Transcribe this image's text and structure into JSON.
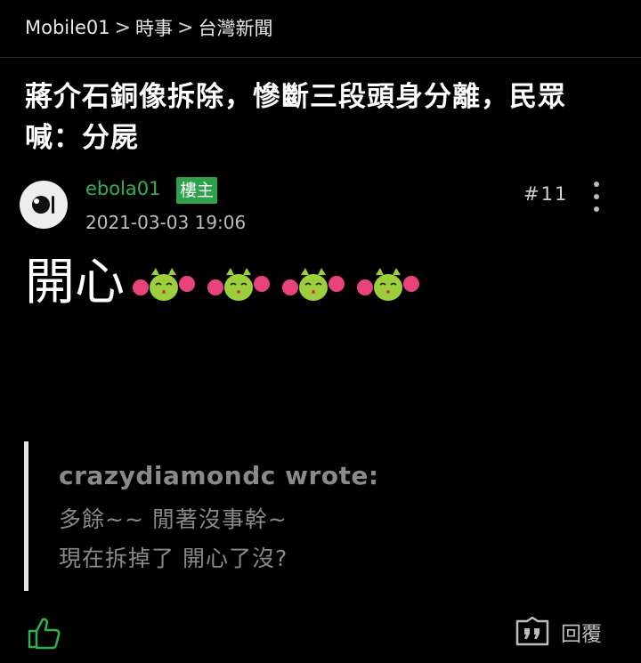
{
  "breadcrumb": {
    "items": [
      "Mobile01",
      "時事",
      "台灣新聞"
    ],
    "separator": ">"
  },
  "post": {
    "title": "蔣介石銅像拆除，慘斷三段頭身分離，民眾喊：分屍",
    "author": "ebola01",
    "owner_badge": "樓主",
    "date": "2021-03-03 19:06",
    "floor": "#11",
    "body": "開心",
    "emote_icon": "cheering-cat-emoji",
    "emote_count": 4
  },
  "quote": {
    "author": "crazydiamondc wrote:",
    "lines": [
      "多餘~~ 閒著沒事幹~",
      "現在拆掉了 開心了沒?"
    ]
  },
  "footer": {
    "reply_label": "回覆"
  },
  "colors": {
    "background": "#000000",
    "author_green": "#2fb24a",
    "badge_green": "#2fa14a",
    "muted_text": "#8a8a8a"
  }
}
